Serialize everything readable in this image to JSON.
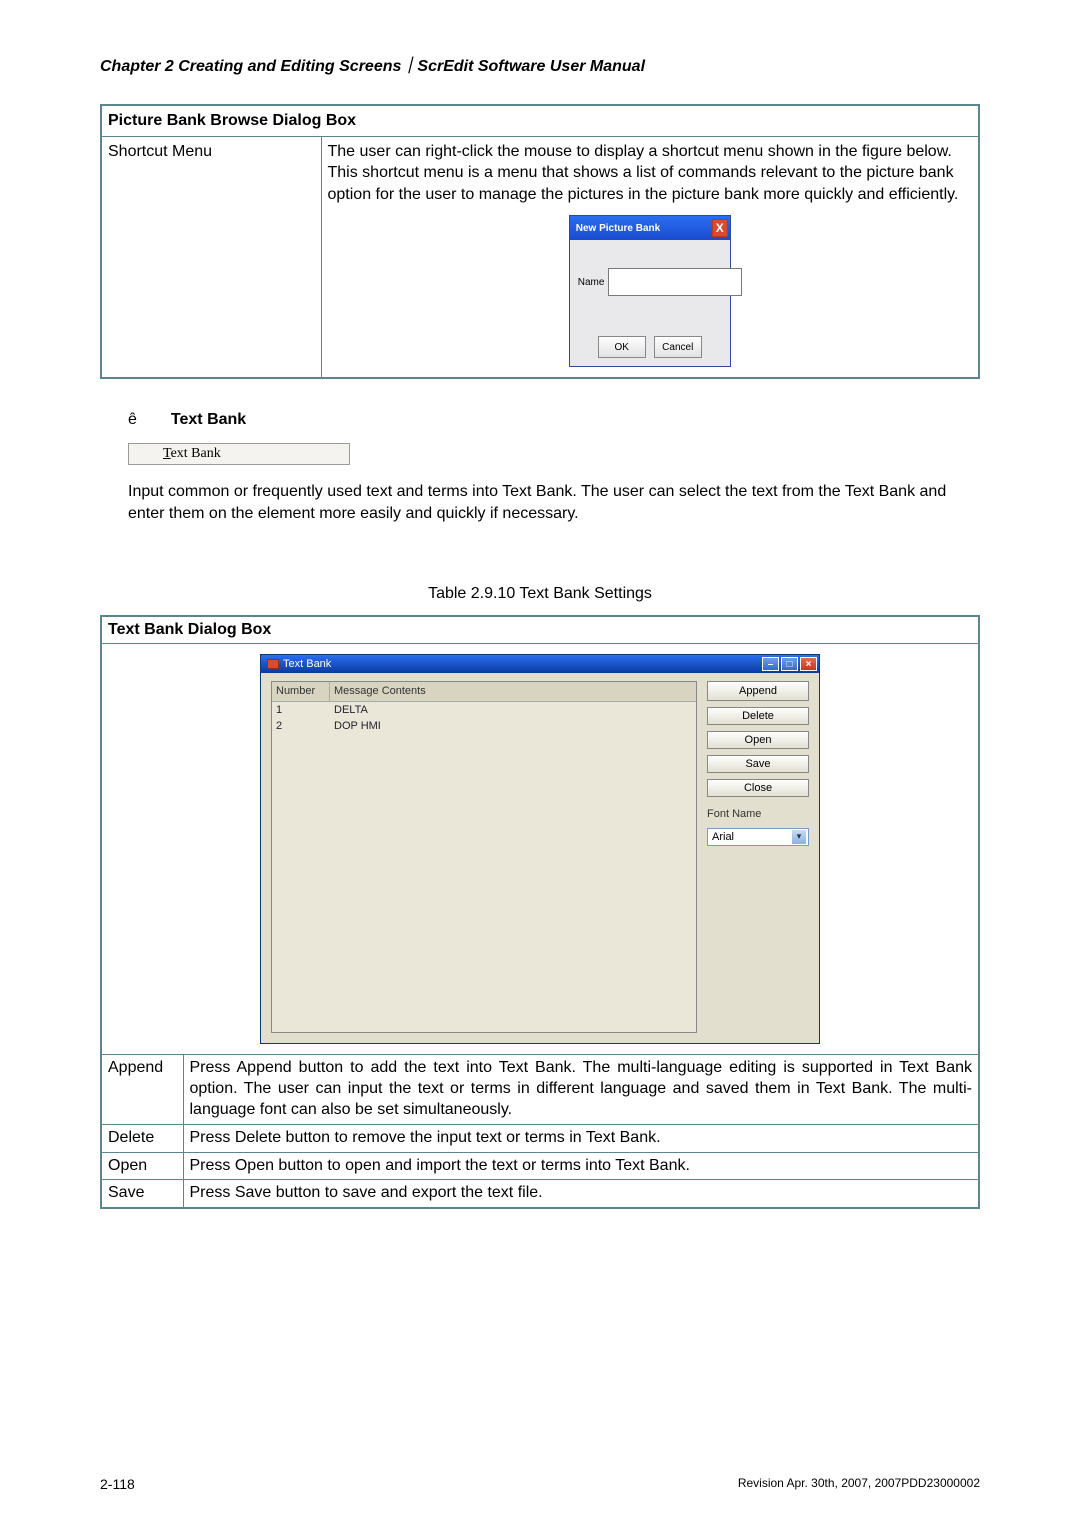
{
  "header": "Chapter 2  Creating and Editing Screens｜ScrEdit Software User Manual",
  "table1": {
    "title": "Picture Bank Browse Dialog Box",
    "rowLabel": "Shortcut Menu",
    "rowText": "The user can right-click the mouse to display a shortcut menu shown in the figure below. This shortcut menu is a menu that shows a list of commands relevant to the picture bank option for the user to manage the pictures in the picture bank more quickly and efficiently."
  },
  "npDialog": {
    "title": "New Picture Bank",
    "fieldLabel": "Name",
    "ok": "OK",
    "cancel": "Cancel"
  },
  "textBank": {
    "bullet": "ê",
    "heading": "Text Bank",
    "menuPrefix": "T",
    "menuRest": "ext Bank",
    "desc": "Input common or frequently used text and terms into Text Bank. The user can select the text from the Text Bank and enter them on the element more easily and quickly if necessary.",
    "caption": "Table 2.9.10 Text Bank Settings"
  },
  "table2": {
    "title": "Text Bank Dialog Box",
    "rows": [
      {
        "k": "Append",
        "v": "Press Append button to add the text into Text Bank. The multi-language editing is supported in Text Bank option. The user can input the text or terms in different language and saved them in Text Bank. The multi-language font can also be set simultaneously."
      },
      {
        "k": "Delete",
        "v": "Press Delete button to remove the input text or terms in Text Bank."
      },
      {
        "k": "Open",
        "v": "Press Open button to open and import the text or terms into Text Bank."
      },
      {
        "k": "Save",
        "v": "Press Save button to save and export the text file."
      }
    ]
  },
  "tbwin": {
    "title": "Text Bank",
    "colNumber": "Number",
    "colMessage": "Message Contents",
    "rows": [
      {
        "n": "1",
        "m": "DELTA"
      },
      {
        "n": "2",
        "m": "DOP HMI"
      }
    ],
    "btnAppend": "Append",
    "btnDelete": "Delete",
    "btnOpen": "Open",
    "btnSave": "Save",
    "btnClose": "Close",
    "fontLabel": "Font Name",
    "fontValue": "Arial"
  },
  "footer": {
    "page": "2-118",
    "rev": "Revision Apr. 30th, 2007, 2007PDD23000002"
  }
}
